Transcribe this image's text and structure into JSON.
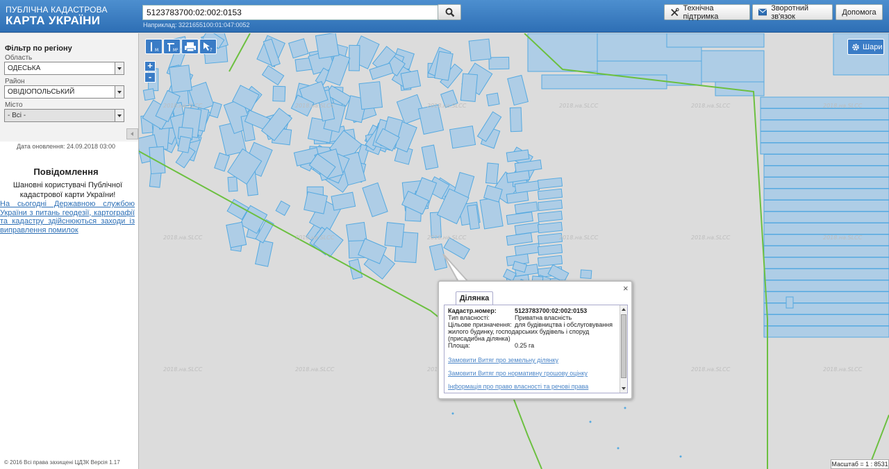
{
  "header": {
    "logo_line1": "ПУБЛІЧНА КАДАСТРОВА",
    "logo_line2": "КАРТА УКРАЇНИ",
    "search_value": "5123783700:02:002:0153",
    "example": "Наприклад: 3221655100:01:047:0052",
    "support_label": "Технічна підтримка",
    "feedback_label": "Зворотний зв'язок",
    "help_label": "Допомога"
  },
  "sidebar": {
    "filter_title": "Фільтр по регіону",
    "region_label": "Область",
    "region_value": "ОДЕСЬКА",
    "district_label": "Район",
    "district_value": "ОВІДІОПОЛЬСЬКИЙ",
    "city_label": "Місто",
    "city_value": "- Всі -",
    "update_date": "Дата оновлення: 24.09.2018 03:00",
    "message_title": "Повідомлення",
    "message_text": "Шановні користувачі Публічної кадастрової карти України!",
    "message_link": "На сьогодні Державною службою України з питань геодезії, картографії та кадастру здійснюються заходи із виправлення помилок",
    "copyright": "© 2016 Всі права захищені  ЦДЗК  Версія 1.17"
  },
  "map": {
    "zoom_in": "+",
    "zoom_out": "-",
    "layers_label": "Шари",
    "watermark": "2018.на.SLCC",
    "scale_label": "Масштаб = 1 : 8531"
  },
  "popup": {
    "close": "×",
    "tab_label": "Ділянка",
    "fields": {
      "cadastral_key": "Кадастр.номер:",
      "cadastral_value": "5123783700:02:002:0153",
      "ownership_key": "Тип власності:",
      "ownership_value": "Приватна власність",
      "purpose_key": "Цільове призначення:",
      "purpose_value": "для будівництва і обслуговування",
      "purpose_cont1": "жилого будинку, господарських будівель і споруд",
      "purpose_cont2": "(присадибна ділянка)",
      "area_key": "Площа:",
      "area_value": "0.25 га"
    },
    "link_extract": "Замовити Витяг про земельну ділянку",
    "link_valuation": "Замовити Витяг про нормативну грошову оцінку",
    "link_rights": "Інформація про право власності та речові права"
  },
  "colors": {
    "header_blue": "#2e6fb5",
    "parcel_fill": "#aecde6",
    "parcel_stroke": "#55a9e0",
    "boundary_green": "#6cc040",
    "link_blue": "#2c6fb6"
  }
}
